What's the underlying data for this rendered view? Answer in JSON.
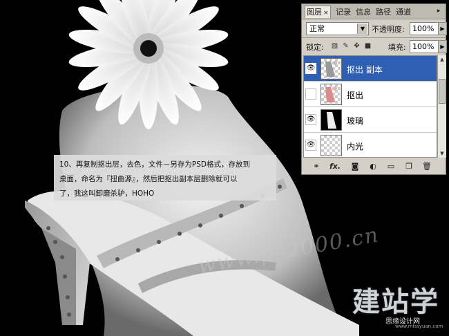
{
  "panel": {
    "tabs": [
      "图层",
      "记录",
      "信息",
      "路径",
      "通道"
    ],
    "tab_close": "×",
    "menu_icon": "▸",
    "blend_mode": "正常",
    "opacity_label": "不透明度:",
    "opacity_value": "100%",
    "lock_label": "锁定:",
    "fill_label": "填充:",
    "fill_value": "100%",
    "layers": [
      {
        "name": "抠出 副本",
        "visible": true,
        "selected": true
      },
      {
        "name": "抠出",
        "visible": false,
        "selected": false
      },
      {
        "name": "玻璃",
        "visible": true,
        "selected": false
      },
      {
        "name": "内光",
        "visible": true,
        "selected": false
      }
    ],
    "bottom_icons": [
      "link-icon",
      "fx-icon",
      "mask-icon",
      "adjustment-icon",
      "group-icon",
      "new-layer-icon",
      "trash-icon"
    ],
    "fx_label": "fx."
  },
  "tutorial": {
    "line1": "10、再复制抠出层，去色，文件－另存为PSD格式，存放到",
    "line2": "桌面，命名为『扭曲源』，然后把抠出副本层删除就可以",
    "line3": "了，我这叫卸磨杀驴，HOHO"
  },
  "watermark": "www.ps2000.cn",
  "logo": {
    "big": "建站学",
    "small": "思缘设计网",
    "url": "www.missyuan.com"
  },
  "colors": {
    "selection": "#2f5fb3",
    "panel": "#d4d0c8"
  }
}
